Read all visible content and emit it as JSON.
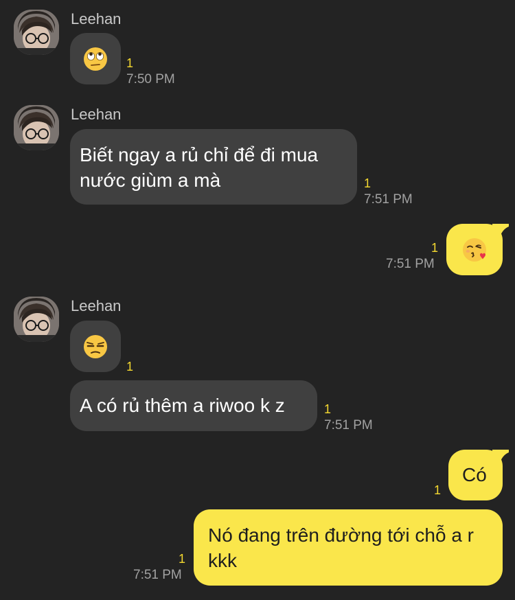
{
  "colors": {
    "background": "#232323",
    "incoming_bubble": "#404040",
    "outgoing_bubble": "#fae64b",
    "unread_count": "#f5d930",
    "timestamp": "#a2a2a2",
    "sender_name": "#c9c9c9"
  },
  "messages": [
    {
      "sender": "Leehan",
      "emoji": "face-with-rolling-eyes-emoji",
      "unread": "1",
      "time": "7:50 PM"
    },
    {
      "sender": "Leehan",
      "text": "Biết ngay a rủ chỉ để đi mua nước giùm a mà",
      "unread": "1",
      "time": "7:51 PM"
    },
    {
      "direction": "outgoing",
      "emoji": "face-blowing-a-kiss-emoji",
      "unread": "1",
      "time": "7:51 PM"
    },
    {
      "sender": "Leehan",
      "emoji": "unamused-face-emoji",
      "unread": "1"
    },
    {
      "text": "A có rủ thêm a riwoo k z",
      "unread": "1",
      "time": "7:51 PM"
    },
    {
      "direction": "outgoing",
      "text": "Có",
      "unread": "1"
    },
    {
      "direction": "outgoing",
      "text": "Nó đang trên đường tới chỗ a r kkk",
      "unread": "1",
      "time": "7:51 PM"
    }
  ]
}
